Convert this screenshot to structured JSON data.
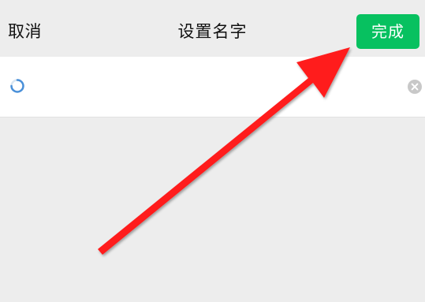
{
  "nav": {
    "cancel_label": "取消",
    "title": "设置名字",
    "done_label": "完成"
  },
  "name_field": {
    "value": "",
    "placeholder": ""
  },
  "icons": {
    "loading": "loading-spinner-icon",
    "clear": "clear-circle-x-icon"
  },
  "colors": {
    "accent_green": "#07c160",
    "background": "#ededed",
    "annotation_red": "#ff1a1a"
  }
}
